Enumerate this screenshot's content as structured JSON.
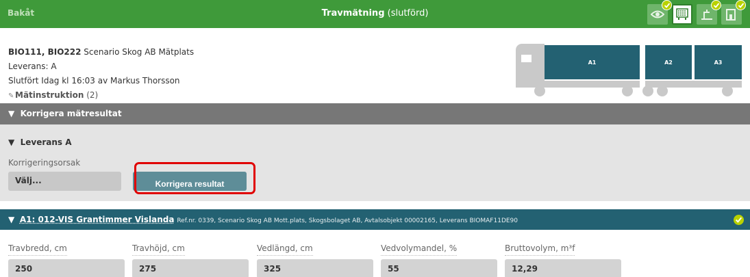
{
  "header": {
    "back_label": "Bakåt",
    "title_main": "Travmätning",
    "title_status": "(slutförd)",
    "steps": [
      {
        "icon": "eye-icon",
        "done": true,
        "active": false
      },
      {
        "icon": "pile-grid-icon",
        "done": false,
        "active": true
      },
      {
        "icon": "scale-icon",
        "done": true,
        "active": false
      },
      {
        "icon": "document-icon",
        "done": true,
        "active": false
      }
    ]
  },
  "info": {
    "ids": "BIO111, BIO222",
    "place": "Scenario Skog AB Mätplats",
    "delivery": "Leverans: A",
    "completed": "Slutfört Idag kl 16:03 av Markus Thorsson",
    "instruction_label": "Mätinstruktion",
    "instruction_count": "(2)"
  },
  "truck": {
    "loads": [
      "A1",
      "A2",
      "A3"
    ]
  },
  "correct_section": {
    "title": "Korrigera mätresultat",
    "sub_title": "Leverans A",
    "reason_label": "Korrigeringsorsak",
    "select_value": "Välj...",
    "button_label": "Korrigera resultat"
  },
  "load_section": {
    "title": "A1: 012-VIS Grantimmer Vislanda",
    "ref": "Ref.nr. 0339, Scenario Skog AB Mott.plats, Skogsbolaget AB, Avtalsobjekt 00002165, Leverans BIOMAF11DE90",
    "fields": [
      {
        "label": "Travbredd, cm",
        "value": "250"
      },
      {
        "label": "Travhöjd, cm",
        "value": "275"
      },
      {
        "label": "Vedlängd, cm",
        "value": "325"
      },
      {
        "label": "Vedvolymandel, %",
        "value": "55"
      },
      {
        "label": "Bruttovolym, m³f",
        "value": "12,29"
      }
    ]
  },
  "colors": {
    "header_green": "#3f9a3a",
    "section_gray": "#777777",
    "teal": "#236172",
    "check_lime": "#b9d200",
    "highlight_red": "#e00000"
  }
}
